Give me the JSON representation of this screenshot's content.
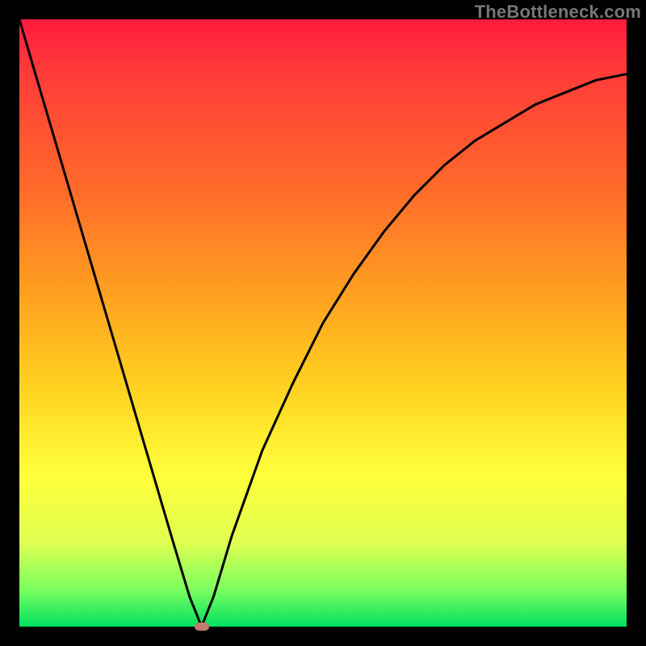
{
  "watermark": "TheBottleneck.com",
  "colors": {
    "frame_border": "#000000",
    "curve": "#000000",
    "min_marker": "#c47a6f",
    "gradient_top": "#ff1a3d",
    "gradient_bottom": "#00e060"
  },
  "chart_data": {
    "type": "line",
    "title": "",
    "xlabel": "",
    "ylabel": "",
    "xlim": [
      0,
      1
    ],
    "ylim": [
      0,
      1
    ],
    "grid": false,
    "legend": false,
    "series": [
      {
        "name": "bottleneck-curve",
        "x": [
          0.0,
          0.05,
          0.1,
          0.15,
          0.2,
          0.25,
          0.28,
          0.3,
          0.32,
          0.35,
          0.4,
          0.45,
          0.5,
          0.55,
          0.6,
          0.65,
          0.7,
          0.75,
          0.8,
          0.85,
          0.9,
          0.95,
          1.0
        ],
        "y": [
          1.0,
          0.83,
          0.66,
          0.49,
          0.32,
          0.15,
          0.05,
          0.0,
          0.05,
          0.15,
          0.29,
          0.4,
          0.5,
          0.58,
          0.65,
          0.71,
          0.76,
          0.8,
          0.83,
          0.86,
          0.88,
          0.9,
          0.91
        ]
      }
    ],
    "min_point": {
      "x": 0.3,
      "y": 0.0
    }
  }
}
